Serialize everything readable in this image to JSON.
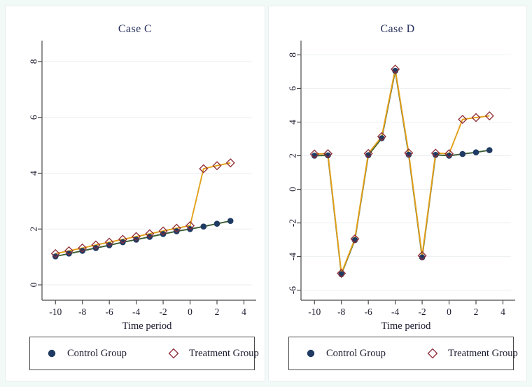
{
  "page": {
    "background_color": "#f2faf7",
    "panel_background": "#ffffff"
  },
  "colors": {
    "control_marker": "#1f3b63",
    "control_line": "#3c5c32",
    "treatment_marker": "#8e2b35",
    "treatment_line": "#e3a11b",
    "title": "#27305c",
    "axis": "#4a4a4a",
    "grid": "#eceef1"
  },
  "panels": [
    {
      "id": "case-c",
      "title": "Case C",
      "legend": {
        "entries": [
          {
            "label": "Control Group",
            "marker": "filled-circle-marker"
          },
          {
            "label": "Treatment Group",
            "marker": "open-diamond-marker"
          }
        ]
      }
    },
    {
      "id": "case-d",
      "title": "Case D",
      "legend": {
        "entries": [
          {
            "label": "Control Group",
            "marker": "filled-circle-marker"
          },
          {
            "label": "Treatment Group",
            "marker": "open-diamond-marker"
          }
        ]
      }
    }
  ],
  "chart_data": [
    {
      "type": "line",
      "title": "Case C",
      "xlabel": "Time period",
      "ylabel": "",
      "xlim": [
        -11,
        4.6
      ],
      "ylim": [
        -0.55,
        8.6
      ],
      "xticks": [
        -10,
        -8,
        -6,
        -4,
        -2,
        0,
        2,
        4
      ],
      "yticks": [
        0,
        2,
        4,
        6,
        8
      ],
      "xticklabels": [
        "-10",
        "-8",
        "-6",
        "-4",
        "-2",
        "0",
        "2",
        "4"
      ],
      "yticklabels": [
        "0",
        "2",
        "4",
        "6",
        "8"
      ],
      "grid": true,
      "legend_position": "below",
      "x": [
        -10,
        -9,
        -8,
        -7,
        -6,
        -5,
        -4,
        -3,
        -2,
        -1,
        0,
        1,
        2,
        3
      ],
      "series": [
        {
          "name": "Control Group",
          "marker": "filled-circle",
          "values": [
            1.02,
            1.12,
            1.22,
            1.32,
            1.42,
            1.53,
            1.62,
            1.72,
            1.82,
            1.92,
            2.0,
            2.09,
            2.19,
            2.29
          ]
        },
        {
          "name": "Treatment Group",
          "marker": "open-diamond",
          "values": [
            1.12,
            1.22,
            1.32,
            1.43,
            1.53,
            1.63,
            1.73,
            1.83,
            1.93,
            2.03,
            2.12,
            4.16,
            4.27,
            4.37
          ]
        }
      ]
    },
    {
      "type": "line",
      "title": "Case D",
      "xlabel": "Time period",
      "ylabel": "",
      "xlim": [
        -11,
        4.6
      ],
      "ylim": [
        -6.6,
        8.6
      ],
      "xticks": [
        -10,
        -8,
        -6,
        -4,
        -2,
        0,
        2,
        4
      ],
      "yticks": [
        -6,
        -4,
        -2,
        0,
        2,
        4,
        6,
        8
      ],
      "xticklabels": [
        "-10",
        "-8",
        "-6",
        "-4",
        "-2",
        "0",
        "2",
        "4"
      ],
      "yticklabels": [
        "-6",
        "-4",
        "-2",
        "0",
        "2",
        "4",
        "6",
        "8"
      ],
      "grid": true,
      "legend_position": "below",
      "x": [
        -10,
        -9,
        -8,
        -7,
        -6,
        -5,
        -4,
        -3,
        -2,
        -1,
        0,
        1,
        2,
        3
      ],
      "series": [
        {
          "name": "Control Group",
          "marker": "filled-circle",
          "values": [
            2.0,
            2.02,
            -5.05,
            -3.02,
            2.03,
            3.04,
            7.05,
            2.06,
            -4.05,
            2.05,
            2.0,
            2.1,
            2.2,
            2.33
          ]
        },
        {
          "name": "Treatment Group",
          "marker": "open-diamond",
          "values": [
            2.1,
            2.12,
            -5.0,
            -2.95,
            2.13,
            3.14,
            7.15,
            2.16,
            -3.95,
            2.15,
            2.12,
            4.16,
            4.27,
            4.37
          ]
        }
      ]
    }
  ]
}
